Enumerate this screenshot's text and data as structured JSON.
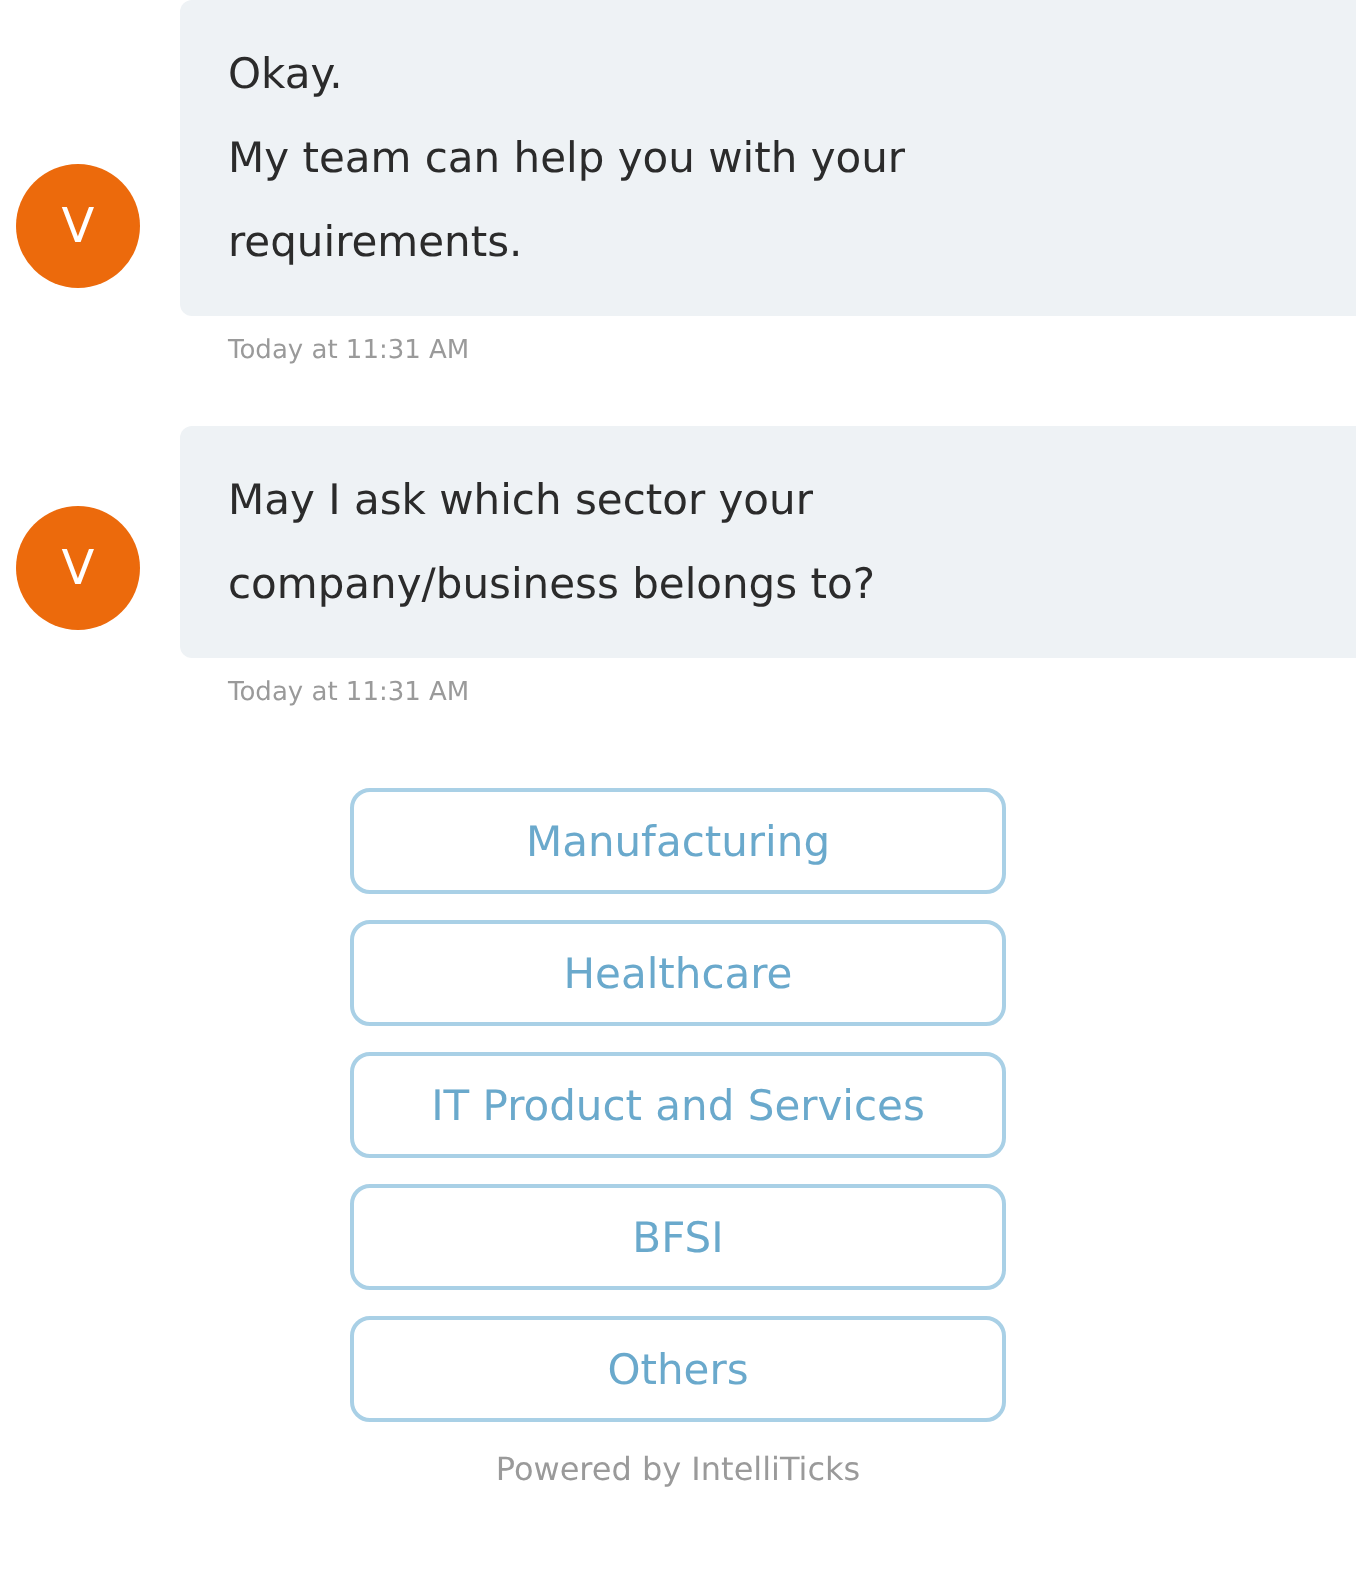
{
  "messages": [
    {
      "avatar": "V",
      "lines": [
        "Okay.",
        "My team can help you with your requirements."
      ],
      "time": "Today at 11:31 AM"
    },
    {
      "avatar": "V",
      "lines": [
        "May I ask which sector your company/business belongs to?"
      ],
      "time": "Today at 11:31 AM"
    }
  ],
  "options": [
    "Manufacturing",
    "Healthcare",
    "IT Product and Services",
    "BFSI",
    "Others"
  ],
  "footer": "Powered by IntelliTicks"
}
